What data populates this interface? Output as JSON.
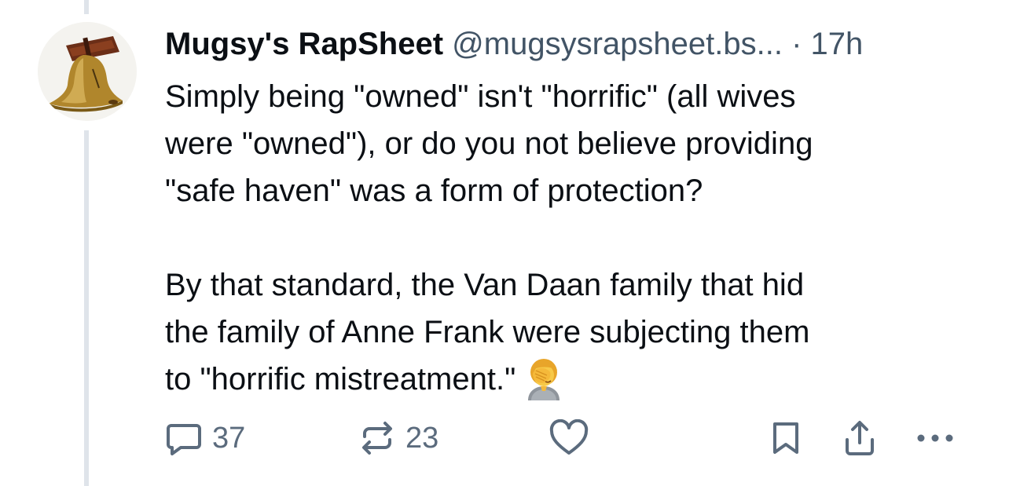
{
  "post": {
    "author": {
      "display_name": "Mugsy's RapSheet",
      "handle": "@mugsysrapsheet.bs...",
      "avatar_icon": "liberty-bell-icon"
    },
    "separator": "·",
    "timestamp": "17h",
    "body": {
      "paragraph_1": "Simply being \"owned\" isn't \"horrific\" (all wives\nwere \"owned\"), or do you not believe providing\n\"safe haven\" was a form of protection?",
      "paragraph_2": "By that standard, the Van Daan family that hid\nthe family of Anne Frank were subjecting them\nto \"horrific mistreatment.\"",
      "trailing_emoji": "facepalm-emoji"
    },
    "actions": {
      "reply_count": "37",
      "repost_count": "23",
      "like_icon": "heart-icon",
      "bookmark_icon": "bookmark-icon",
      "share_icon": "share-icon",
      "more_icon": "more-icon"
    }
  },
  "colors": {
    "text": "#0b0f14",
    "muted": "#425466",
    "icon": "#5b6b7d",
    "thread_line": "#dfe4ea"
  }
}
